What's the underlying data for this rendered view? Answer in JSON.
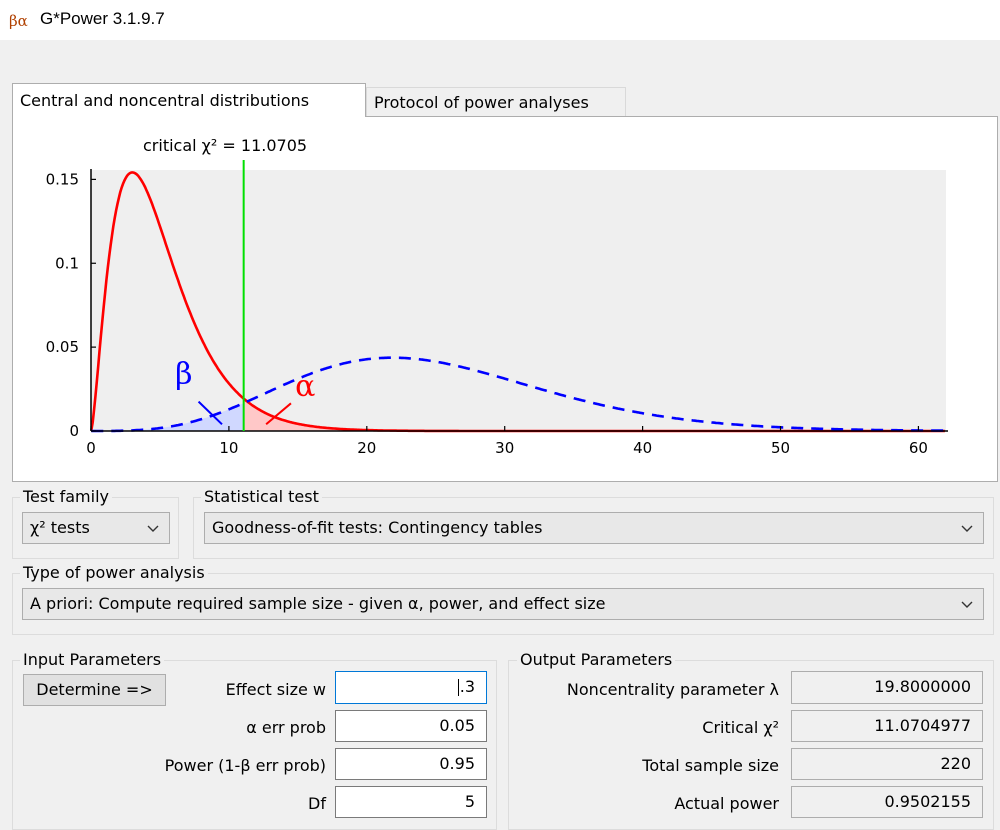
{
  "window": {
    "title": "G*Power 3.1.9.7",
    "icon_glyphs": "βα"
  },
  "tabs": [
    {
      "label": "Central and noncentral distributions",
      "active": true
    },
    {
      "label": "Protocol of power analyses",
      "active": false
    }
  ],
  "chart_data": {
    "type": "line",
    "title": "critical χ² =  11.0705",
    "critical_value": 11.0705,
    "xlim": [
      0,
      62
    ],
    "ylim": [
      0,
      0.155
    ],
    "x_ticks": [
      0,
      10,
      20,
      30,
      40,
      50,
      60
    ],
    "y_ticks": [
      0,
      0.05,
      0.1,
      0.15
    ],
    "x_tick_labels": [
      "0",
      "10",
      "20",
      "30",
      "40",
      "50",
      "60"
    ],
    "y_tick_labels": [
      "0",
      "0.05",
      "0.1",
      "0.15"
    ],
    "grid": false,
    "series": [
      {
        "label_glyph": "α",
        "style": "solid",
        "color": "#ff0000",
        "df": 5,
        "noncentrality": 0
      },
      {
        "label_glyph": "β",
        "style": "dashed",
        "color": "#0000ff",
        "df": 5,
        "noncentrality": 19.8
      }
    ],
    "critical_line_color": "#00e000"
  },
  "test_family": {
    "legend": "Test family",
    "value": "χ² tests"
  },
  "statistical_test": {
    "legend": "Statistical test",
    "value": "Goodness-of-fit tests: Contingency tables"
  },
  "power_analysis_type": {
    "legend": "Type of power analysis",
    "value": "A priori: Compute required sample size - given α, power, and effect size"
  },
  "input_parameters": {
    "legend": "Input Parameters",
    "determine_label": "Determine =>",
    "rows": [
      {
        "label": "Effect size w",
        "value": ".3"
      },
      {
        "label": "α err prob",
        "value": "0.05"
      },
      {
        "label": "Power (1-β err prob)",
        "value": "0.95"
      },
      {
        "label": "Df",
        "value": "5"
      }
    ]
  },
  "output_parameters": {
    "legend": "Output Parameters",
    "rows": [
      {
        "label": "Noncentrality parameter λ",
        "value": "19.8000000"
      },
      {
        "label": "Critical χ²",
        "value": "11.0704977"
      },
      {
        "label": "Total sample size",
        "value": "220"
      },
      {
        "label": "Actual power",
        "value": "0.9502155"
      }
    ]
  },
  "colors": {
    "accent_focus": "#0078d7",
    "plot_background": "#efefef"
  }
}
